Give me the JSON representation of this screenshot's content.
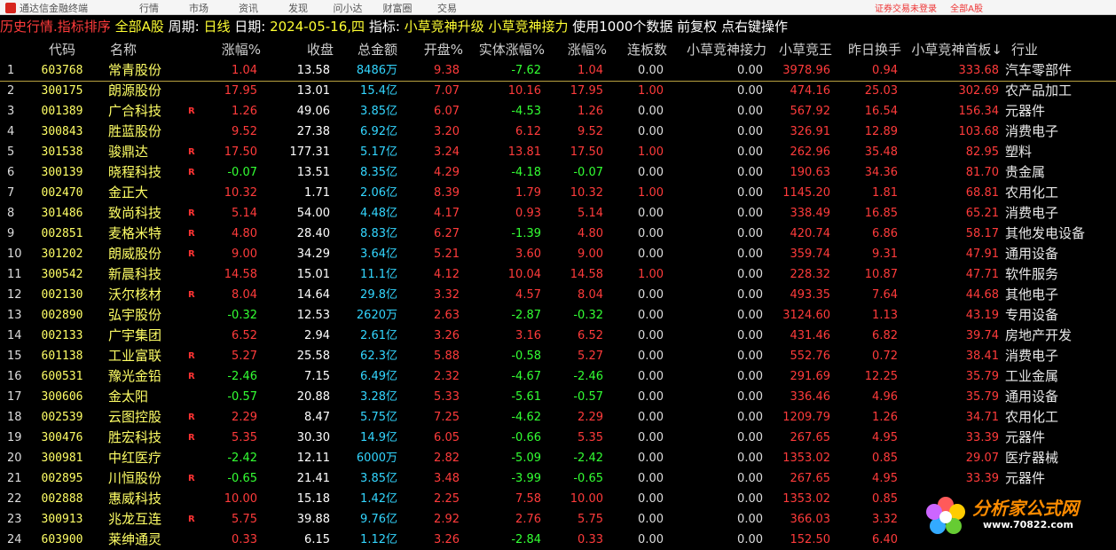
{
  "app": {
    "title": "通达信金融终端",
    "menu": [
      "行情",
      "市场",
      "资讯",
      "发现",
      "问小达",
      "财富圈",
      "交易"
    ],
    "right_status": [
      "证券交易未登录",
      "全部A股"
    ]
  },
  "status": {
    "mode": "历史行情.指标排序",
    "scope": "全部A股",
    "period_label": "周期:",
    "period": "日线",
    "date_label": "日期:",
    "date": "2024-05-16,四",
    "indicator_label": "指标:",
    "indicator": "小草竞神升级 小草竞神接力",
    "note": "使用1000个数据 前复权 点右键操作"
  },
  "table": {
    "headers": [
      "代码",
      "名称",
      "涨幅%",
      "收盘",
      "总金额",
      "开盘%",
      "实体涨幅%",
      "涨幅%",
      "连板数",
      "小草竞神接力",
      "小草竞王",
      "昨日换手",
      "小草竞神首板↓",
      "行业"
    ],
    "rows": [
      {
        "i": "1",
        "code": "603768",
        "name": "常青股份",
        "r": "",
        "chg": "1.04",
        "close": "13.58",
        "amt": "8486万",
        "open": "9.38",
        "body": "-7.62",
        "chg2": "1.04",
        "lb": "0.00",
        "jl": "0.00",
        "jw": "3978.96",
        "hs": "0.94",
        "sb": "333.68",
        "ind": "汽车零部件",
        "d_chg": "up",
        "d_open": "up",
        "d_body": "down",
        "d_jw": "up",
        "d_hs": "up",
        "d_sb": "up",
        "d_lb": "flat"
      },
      {
        "i": "2",
        "code": "300175",
        "name": "朗源股份",
        "r": "",
        "chg": "17.95",
        "close": "13.01",
        "amt": "15.4亿",
        "open": "7.07",
        "body": "10.16",
        "chg2": "17.95",
        "lb": "1.00",
        "jl": "0.00",
        "jw": "474.16",
        "hs": "25.03",
        "sb": "302.69",
        "ind": "农产品加工",
        "d_chg": "up",
        "d_open": "up",
        "d_body": "up",
        "d_jw": "up",
        "d_hs": "up",
        "d_sb": "up",
        "d_lb": "up"
      },
      {
        "i": "3",
        "code": "001389",
        "name": "广合科技",
        "r": "R",
        "chg": "1.26",
        "close": "49.06",
        "amt": "3.85亿",
        "open": "6.07",
        "body": "-4.53",
        "chg2": "1.26",
        "lb": "0.00",
        "jl": "0.00",
        "jw": "567.92",
        "hs": "16.54",
        "sb": "156.34",
        "ind": "元器件",
        "d_chg": "up",
        "d_open": "up",
        "d_body": "down",
        "d_jw": "up",
        "d_hs": "up",
        "d_sb": "up",
        "d_lb": "flat"
      },
      {
        "i": "4",
        "code": "300843",
        "name": "胜蓝股份",
        "r": "",
        "chg": "9.52",
        "close": "27.38",
        "amt": "6.92亿",
        "open": "3.20",
        "body": "6.12",
        "chg2": "9.52",
        "lb": "0.00",
        "jl": "0.00",
        "jw": "326.91",
        "hs": "12.89",
        "sb": "103.68",
        "ind": "消费电子",
        "d_chg": "up",
        "d_open": "up",
        "d_body": "up",
        "d_jw": "up",
        "d_hs": "up",
        "d_sb": "up",
        "d_lb": "flat"
      },
      {
        "i": "5",
        "code": "301538",
        "name": "骏鼎达",
        "r": "R",
        "chg": "17.50",
        "close": "177.31",
        "amt": "5.17亿",
        "open": "3.24",
        "body": "13.81",
        "chg2": "17.50",
        "lb": "1.00",
        "jl": "0.00",
        "jw": "262.96",
        "hs": "35.48",
        "sb": "82.95",
        "ind": "塑料",
        "d_chg": "up",
        "d_open": "up",
        "d_body": "up",
        "d_jw": "up",
        "d_hs": "up",
        "d_sb": "up",
        "d_lb": "up"
      },
      {
        "i": "6",
        "code": "300139",
        "name": "晓程科技",
        "r": "R",
        "chg": "-0.07",
        "close": "13.51",
        "amt": "8.35亿",
        "open": "4.29",
        "body": "-4.18",
        "chg2": "-0.07",
        "lb": "0.00",
        "jl": "0.00",
        "jw": "190.63",
        "hs": "34.36",
        "sb": "81.70",
        "ind": "贵金属",
        "d_chg": "down",
        "d_open": "up",
        "d_body": "down",
        "d_jw": "up",
        "d_hs": "up",
        "d_sb": "up",
        "d_lb": "flat"
      },
      {
        "i": "7",
        "code": "002470",
        "name": "金正大",
        "r": "",
        "chg": "10.32",
        "close": "1.71",
        "amt": "2.06亿",
        "open": "8.39",
        "body": "1.79",
        "chg2": "10.32",
        "lb": "1.00",
        "jl": "0.00",
        "jw": "1145.20",
        "hs": "1.81",
        "sb": "68.81",
        "ind": "农用化工",
        "d_chg": "up",
        "d_open": "up",
        "d_body": "up",
        "d_jw": "up",
        "d_hs": "up",
        "d_sb": "up",
        "d_lb": "up"
      },
      {
        "i": "8",
        "code": "301486",
        "name": "致尚科技",
        "r": "R",
        "chg": "5.14",
        "close": "54.00",
        "amt": "4.48亿",
        "open": "4.17",
        "body": "0.93",
        "chg2": "5.14",
        "lb": "0.00",
        "jl": "0.00",
        "jw": "338.49",
        "hs": "16.85",
        "sb": "65.21",
        "ind": "消费电子",
        "d_chg": "up",
        "d_open": "up",
        "d_body": "up",
        "d_jw": "up",
        "d_hs": "up",
        "d_sb": "up",
        "d_lb": "flat"
      },
      {
        "i": "9",
        "code": "002851",
        "name": "麦格米特",
        "r": "R",
        "chg": "4.80",
        "close": "28.40",
        "amt": "8.83亿",
        "open": "6.27",
        "body": "-1.39",
        "chg2": "4.80",
        "lb": "0.00",
        "jl": "0.00",
        "jw": "420.74",
        "hs": "6.86",
        "sb": "58.17",
        "ind": "其他发电设备",
        "d_chg": "up",
        "d_open": "up",
        "d_body": "down",
        "d_jw": "up",
        "d_hs": "up",
        "d_sb": "up",
        "d_lb": "flat"
      },
      {
        "i": "10",
        "code": "301202",
        "name": "朗威股份",
        "r": "R",
        "chg": "9.00",
        "close": "34.29",
        "amt": "3.64亿",
        "open": "5.21",
        "body": "3.60",
        "chg2": "9.00",
        "lb": "0.00",
        "jl": "0.00",
        "jw": "359.74",
        "hs": "9.31",
        "sb": "47.91",
        "ind": "通用设备",
        "d_chg": "up",
        "d_open": "up",
        "d_body": "up",
        "d_jw": "up",
        "d_hs": "up",
        "d_sb": "up",
        "d_lb": "flat"
      },
      {
        "i": "11",
        "code": "300542",
        "name": "新晨科技",
        "r": "",
        "chg": "14.58",
        "close": "15.01",
        "amt": "11.1亿",
        "open": "4.12",
        "body": "10.04",
        "chg2": "14.58",
        "lb": "1.00",
        "jl": "0.00",
        "jw": "228.32",
        "hs": "10.87",
        "sb": "47.71",
        "ind": "软件服务",
        "d_chg": "up",
        "d_open": "up",
        "d_body": "up",
        "d_jw": "up",
        "d_hs": "up",
        "d_sb": "up",
        "d_lb": "up"
      },
      {
        "i": "12",
        "code": "002130",
        "name": "沃尔核材",
        "r": "R",
        "chg": "8.04",
        "close": "14.64",
        "amt": "29.8亿",
        "open": "3.32",
        "body": "4.57",
        "chg2": "8.04",
        "lb": "0.00",
        "jl": "0.00",
        "jw": "493.35",
        "hs": "7.64",
        "sb": "44.68",
        "ind": "其他电子",
        "d_chg": "up",
        "d_open": "up",
        "d_body": "up",
        "d_jw": "up",
        "d_hs": "up",
        "d_sb": "up",
        "d_lb": "flat"
      },
      {
        "i": "13",
        "code": "002890",
        "name": "弘宇股份",
        "r": "",
        "chg": "-0.32",
        "close": "12.53",
        "amt": "2620万",
        "open": "2.63",
        "body": "-2.87",
        "chg2": "-0.32",
        "lb": "0.00",
        "jl": "0.00",
        "jw": "3124.60",
        "hs": "1.13",
        "sb": "43.19",
        "ind": "专用设备",
        "d_chg": "down",
        "d_open": "up",
        "d_body": "down",
        "d_jw": "up",
        "d_hs": "up",
        "d_sb": "up",
        "d_lb": "flat"
      },
      {
        "i": "14",
        "code": "002133",
        "name": "广宇集团",
        "r": "",
        "chg": "6.52",
        "close": "2.94",
        "amt": "2.61亿",
        "open": "3.26",
        "body": "3.16",
        "chg2": "6.52",
        "lb": "0.00",
        "jl": "0.00",
        "jw": "431.46",
        "hs": "6.82",
        "sb": "39.74",
        "ind": "房地产开发",
        "d_chg": "up",
        "d_open": "up",
        "d_body": "up",
        "d_jw": "up",
        "d_hs": "up",
        "d_sb": "up",
        "d_lb": "flat"
      },
      {
        "i": "15",
        "code": "601138",
        "name": "工业富联",
        "r": "R",
        "chg": "5.27",
        "close": "25.58",
        "amt": "62.3亿",
        "open": "5.88",
        "body": "-0.58",
        "chg2": "5.27",
        "lb": "0.00",
        "jl": "0.00",
        "jw": "552.76",
        "hs": "0.72",
        "sb": "38.41",
        "ind": "消费电子",
        "d_chg": "up",
        "d_open": "up",
        "d_body": "down",
        "d_jw": "up",
        "d_hs": "up",
        "d_sb": "up",
        "d_lb": "flat"
      },
      {
        "i": "16",
        "code": "600531",
        "name": "豫光金铅",
        "r": "R",
        "chg": "-2.46",
        "close": "7.15",
        "amt": "6.49亿",
        "open": "2.32",
        "body": "-4.67",
        "chg2": "-2.46",
        "lb": "0.00",
        "jl": "0.00",
        "jw": "291.69",
        "hs": "12.25",
        "sb": "35.79",
        "ind": "工业金属",
        "d_chg": "down",
        "d_open": "up",
        "d_body": "down",
        "d_jw": "up",
        "d_hs": "up",
        "d_sb": "up",
        "d_lb": "flat"
      },
      {
        "i": "17",
        "code": "300606",
        "name": "金太阳",
        "r": "",
        "chg": "-0.57",
        "close": "20.88",
        "amt": "3.28亿",
        "open": "5.33",
        "body": "-5.61",
        "chg2": "-0.57",
        "lb": "0.00",
        "jl": "0.00",
        "jw": "336.46",
        "hs": "4.96",
        "sb": "35.79",
        "ind": "通用设备",
        "d_chg": "down",
        "d_open": "up",
        "d_body": "down",
        "d_jw": "up",
        "d_hs": "up",
        "d_sb": "up",
        "d_lb": "flat"
      },
      {
        "i": "18",
        "code": "002539",
        "name": "云图控股",
        "r": "R",
        "chg": "2.29",
        "close": "8.47",
        "amt": "5.75亿",
        "open": "7.25",
        "body": "-4.62",
        "chg2": "2.29",
        "lb": "0.00",
        "jl": "0.00",
        "jw": "1209.79",
        "hs": "1.26",
        "sb": "34.71",
        "ind": "农用化工",
        "d_chg": "up",
        "d_open": "up",
        "d_body": "down",
        "d_jw": "up",
        "d_hs": "up",
        "d_sb": "up",
        "d_lb": "flat"
      },
      {
        "i": "19",
        "code": "300476",
        "name": "胜宏科技",
        "r": "R",
        "chg": "5.35",
        "close": "30.30",
        "amt": "14.9亿",
        "open": "6.05",
        "body": "-0.66",
        "chg2": "5.35",
        "lb": "0.00",
        "jl": "0.00",
        "jw": "267.65",
        "hs": "4.95",
        "sb": "33.39",
        "ind": "元器件",
        "d_chg": "up",
        "d_open": "up",
        "d_body": "down",
        "d_jw": "up",
        "d_hs": "up",
        "d_sb": "up",
        "d_lb": "flat"
      },
      {
        "i": "20",
        "code": "300981",
        "name": "中红医疗",
        "r": "",
        "chg": "-2.42",
        "close": "12.11",
        "amt": "6000万",
        "open": "2.82",
        "body": "-5.09",
        "chg2": "-2.42",
        "lb": "0.00",
        "jl": "0.00",
        "jw": "1353.02",
        "hs": "0.85",
        "sb": "29.07",
        "ind": "医疗器械",
        "d_chg": "down",
        "d_open": "up",
        "d_body": "down",
        "d_jw": "up",
        "d_hs": "up",
        "d_sb": "up",
        "d_lb": "flat"
      },
      {
        "i": "21",
        "code": "002895",
        "name": "川恒股份",
        "r": "R",
        "chg": "-0.65",
        "close": "21.41",
        "amt": "3.85亿",
        "open": "3.48",
        "body": "-3.99",
        "chg2": "-0.65",
        "lb": "0.00",
        "jl": "0.00",
        "jw": "267.65",
        "hs": "4.95",
        "sb": "33.39",
        "ind": "元器件",
        "d_chg": "down",
        "d_open": "up",
        "d_body": "down",
        "d_jw": "up",
        "d_hs": "up",
        "d_sb": "up",
        "d_lb": "flat"
      },
      {
        "i": "22",
        "code": "002888",
        "name": "惠威科技",
        "r": "",
        "chg": "10.00",
        "close": "15.18",
        "amt": "1.42亿",
        "open": "2.25",
        "body": "7.58",
        "chg2": "10.00",
        "lb": "0.00",
        "jl": "0.00",
        "jw": "1353.02",
        "hs": "0.85",
        "sb": "",
        "ind": "",
        "d_chg": "up",
        "d_open": "up",
        "d_body": "up",
        "d_jw": "up",
        "d_hs": "up",
        "d_sb": "up",
        "d_lb": "flat"
      },
      {
        "i": "23",
        "code": "300913",
        "name": "兆龙互连",
        "r": "R",
        "chg": "5.75",
        "close": "39.88",
        "amt": "9.76亿",
        "open": "2.92",
        "body": "2.76",
        "chg2": "5.75",
        "lb": "0.00",
        "jl": "0.00",
        "jw": "366.03",
        "hs": "3.32",
        "sb": "",
        "ind": "",
        "d_chg": "up",
        "d_open": "up",
        "d_body": "up",
        "d_jw": "up",
        "d_hs": "up",
        "d_sb": "up",
        "d_lb": "flat"
      },
      {
        "i": "24",
        "code": "603900",
        "name": "莱绅通灵",
        "r": "",
        "chg": "0.33",
        "close": "6.15",
        "amt": "1.12亿",
        "open": "3.26",
        "body": "-2.84",
        "chg2": "0.33",
        "lb": "0.00",
        "jl": "0.00",
        "jw": "152.50",
        "hs": "6.40",
        "sb": "",
        "ind": "",
        "d_chg": "up",
        "d_open": "up",
        "d_body": "down",
        "d_jw": "up",
        "d_hs": "up",
        "d_sb": "up",
        "d_lb": "flat"
      }
    ]
  },
  "watermark": {
    "title": "分析家公式网",
    "url": "www.70822.com"
  },
  "colors": {
    "up": "#ff3b3b",
    "down": "#33ff33",
    "code": "#ffff66",
    "amount": "#33d6ff",
    "bg": "#000000"
  }
}
